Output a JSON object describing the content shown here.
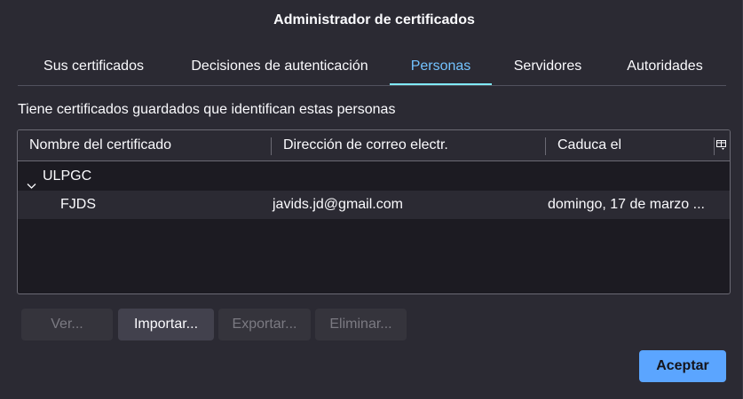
{
  "window": {
    "title": "Administrador de certificados"
  },
  "tabs": [
    {
      "label": "Sus certificados",
      "selected": false
    },
    {
      "label": "Decisiones de autenticación",
      "selected": false
    },
    {
      "label": "Personas",
      "selected": true
    },
    {
      "label": "Servidores",
      "selected": false
    },
    {
      "label": "Autoridades",
      "selected": false
    }
  ],
  "description": "Tiene certificados guardados que identifican estas personas",
  "table": {
    "columns": [
      "Nombre del certificado",
      "Dirección de correo electr.",
      "Caduca el"
    ],
    "column_picker_icon": "column-picker-icon",
    "group": {
      "label": "ULPGC",
      "expanded": true
    },
    "rows": [
      {
        "name": "FJDS",
        "email": "javids.jd@gmail.com",
        "expires": "domingo, 17 de marzo ..."
      }
    ]
  },
  "buttons": {
    "view": "Ver...",
    "import": "Importar...",
    "export": "Exportar...",
    "delete": "Eliminar...",
    "accept": "Aceptar"
  },
  "colors": {
    "accent": "#80ebff",
    "primary_button": "#5ba5ff",
    "background": "#2b2a33",
    "tree_background": "#1c1b22"
  }
}
